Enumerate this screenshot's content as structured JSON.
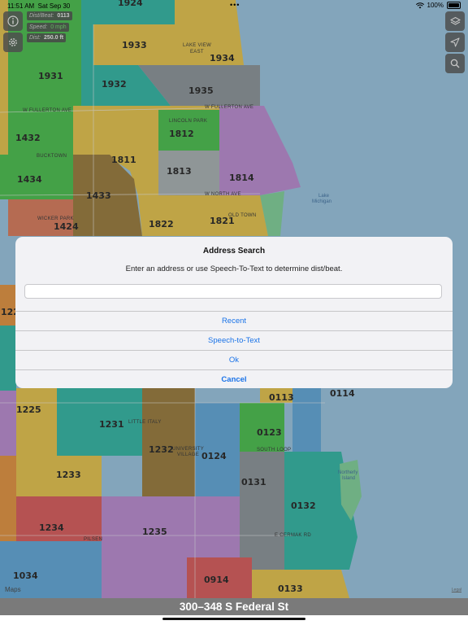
{
  "status_bar": {
    "time": "11:51 AM",
    "date": "Sat Sep 30",
    "dots": "•••",
    "battery": "100%"
  },
  "info_panel": {
    "dist_beat_label": "Dist/Beat:",
    "dist_beat_value": "0113",
    "speed_label": "Speed:",
    "speed_value": "0 mph",
    "dist_label": "Dist:",
    "dist_value": "250.0 ft"
  },
  "icons": {
    "info": "info-icon",
    "settings": "gear-icon",
    "layers": "layers-icon",
    "locate": "location-arrow-icon",
    "search": "search-icon"
  },
  "map": {
    "beats": [
      "1924",
      "1933",
      "1934",
      "1931",
      "1932",
      "1935",
      "1432",
      "1812",
      "1434",
      "1811",
      "1813",
      "1814",
      "1433",
      "1424",
      "1822",
      "1821",
      "122",
      "0113",
      "0114",
      "1225",
      "1231",
      "0123",
      "1232",
      "0124",
      "1233",
      "0131",
      "0132",
      "1234",
      "1235",
      "1034",
      "0914",
      "0133"
    ],
    "places": {
      "lakeview_east_1": "LAKE VIEW",
      "lakeview_east_2": "EAST",
      "lincoln_park": "LINCOLN PARK",
      "bucktown": "BUCKTOWN",
      "wicker_park": "WICKER PARK",
      "old_town": "OLD TOWN",
      "lake_michigan_1": "Lake",
      "lake_michigan_2": "Michigan",
      "pilsen": "PILSEN",
      "south_loop": "SOUTH LOOP",
      "university_village_1": "UNIVERSITY",
      "university_village_2": "VILLAGE",
      "little_italy": "LITTLE ITALY",
      "northerly_island_1": "Northerly",
      "northerly_island_2": "Island",
      "w_fullerton_ave": "W FULLERTON AVE",
      "w_north_ave": "W NORTH AVE",
      "e_cermak_rd": "E CERMAK RD"
    },
    "colors": {
      "water": "#a8d4f0",
      "yellow": "#f5d35a",
      "teal": "#3fc6b4",
      "green": "#58cf5c",
      "brown": "#a88a4a",
      "purple": "#c99ae0",
      "gray": "#9aa3a8",
      "orange": "#f2a24e",
      "red": "#e86a6a",
      "mint": "#8fe0a8",
      "blue": "#6fb7e8"
    }
  },
  "dialog": {
    "title": "Address Search",
    "message": "Enter an address or use Speech-To-Text to determine dist/beat.",
    "input_value": "",
    "recent": "Recent",
    "speech": "Speech-to-Text",
    "ok": "Ok",
    "cancel": "Cancel"
  },
  "address_bar": "300–348 S Federal St",
  "maps_logo": "Maps",
  "legal": "Legal"
}
